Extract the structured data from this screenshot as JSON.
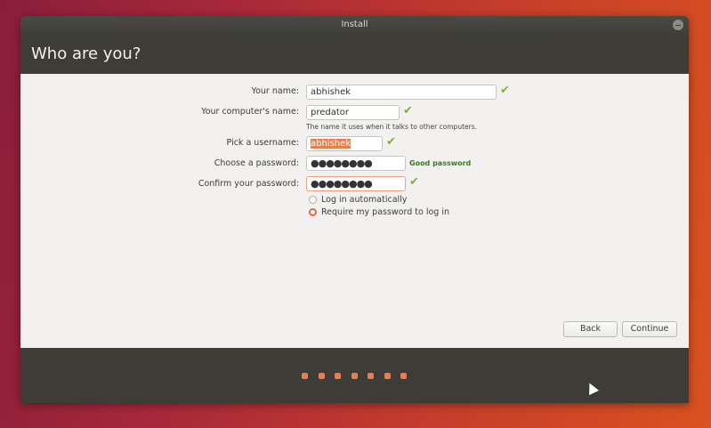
{
  "window": {
    "title": "Install"
  },
  "page_title": "Who are you?",
  "form": {
    "your_name": {
      "label": "Your name:",
      "value": "abhishek"
    },
    "computer_name": {
      "label": "Your computer's name:",
      "value": "predator",
      "hint": "The name it uses when it talks to other computers."
    },
    "username": {
      "label": "Pick a username:",
      "value": "abhishek"
    },
    "password": {
      "label": "Choose a password:",
      "value": "●●●●●●●●",
      "strength": "Good password"
    },
    "confirm": {
      "label": "Confirm your password:",
      "value": "●●●●●●●●"
    },
    "login_options": [
      {
        "label": "Log in automatically",
        "selected": false
      },
      {
        "label": "Require my password to log in",
        "selected": true
      }
    ]
  },
  "buttons": {
    "back": "Back",
    "continue": "Continue"
  },
  "progress": {
    "total_steps": 7
  },
  "colors": {
    "accent": "#e67e4f",
    "check": "#7fb03a"
  }
}
